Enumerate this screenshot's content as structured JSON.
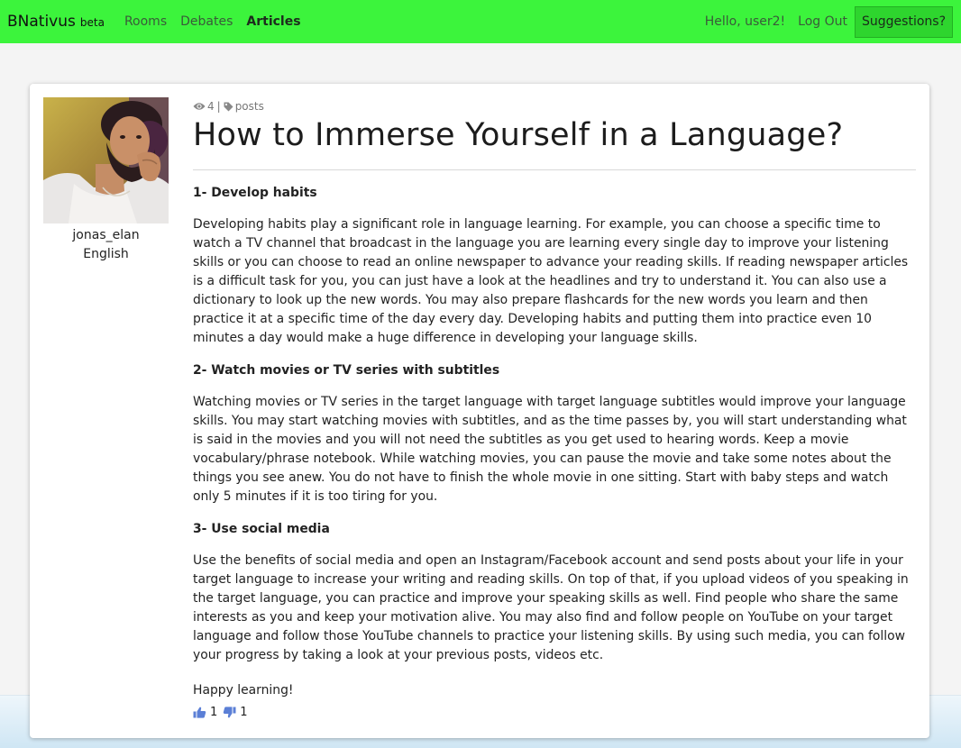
{
  "nav": {
    "brand": "BNativus",
    "brand_tag": "beta",
    "links": [
      {
        "label": "Rooms"
      },
      {
        "label": "Debates"
      },
      {
        "label": "Articles"
      }
    ],
    "greeting": "Hello, user2!",
    "logout": "Log Out",
    "suggestions": "Suggestions?"
  },
  "author": {
    "username": "jonas_elan",
    "language": "English"
  },
  "article": {
    "views": "4",
    "separator": "|",
    "tag": "posts",
    "title": "How to Immerse Yourself in a Language?",
    "sections": [
      {
        "heading": "1- Develop habits",
        "text": "Developing habits play a significant role in language learning. For example, you can choose a specific time to watch a TV channel that broadcast in the language you are learning every single day to improve your listening skills or you can choose to read an online newspaper to advance your reading skills. If reading newspaper articles is a difficult task for you, you can just have a look at the headlines and try to understand it. You can also use a dictionary to look up the new words. You may also prepare flashcards for the new words you learn and then practice it at a specific time of the day every day. Developing habits and putting them into practice even 10 minutes a day would make a huge difference in developing your language skills."
      },
      {
        "heading": "2- Watch movies or TV series with subtitles",
        "text": "Watching movies or TV series in the target language with target language subtitles would improve your language skills. You may start watching movies with subtitles, and as the time passes by, you will start understanding what is said in the movies and you will not need the subtitles as you get used to hearing words. Keep a movie vocabulary/phrase notebook. While watching movies, you can pause the movie and take some notes about the things you see anew. You do not have to finish the whole movie in one sitting. Start with baby steps and watch only 5 minutes if it is too tiring for you."
      },
      {
        "heading": "3- Use social media",
        "text": "Use the benefits of social media and open an Instagram/Facebook account and send posts about your life in your target language to increase your writing and reading skills. On top of that, if you upload videos of you speaking in the target language, you can practice and improve your speaking skills as well. Find people who share the same interests as you and keep your motivation alive. You may also find and follow people on YouTube on your target language and follow those YouTube channels to practice your listening skills. By using such media, you can follow your progress by taking a look at your previous posts, videos etc."
      }
    ],
    "closing": "Happy learning!",
    "likes": "1",
    "dislikes": "1"
  },
  "colors": {
    "navbar_bg": "#3cf43c",
    "suggest_bg": "#2ed52e",
    "page_bg": "#f4f4f4",
    "vote_icon": "#5b7fd6"
  },
  "icons": {
    "views": "eye-icon",
    "tag": "tag-icon",
    "like": "thumbs-up-icon",
    "dislike": "thumbs-down-icon"
  }
}
